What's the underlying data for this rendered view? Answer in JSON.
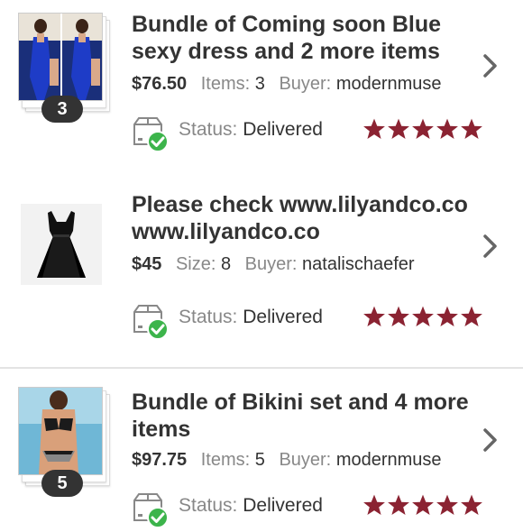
{
  "orders": [
    {
      "title": "Bundle of Coming soon Blue sexy dress and 2 more items",
      "price": "$76.50",
      "detail_label": "Items:",
      "detail_value": "3",
      "buyer_label": "Buyer:",
      "buyer": "modernmuse",
      "count_badge": "3",
      "status_label": "Status:",
      "status": "Delivered",
      "rating": 5
    },
    {
      "title": "Please check www.lilyandco.co www.lilyandco.co",
      "price": "$45",
      "detail_label": "Size:",
      "detail_value": "8",
      "buyer_label": "Buyer:",
      "buyer": "natalischaefer",
      "status_label": "Status:",
      "status": "Delivered",
      "rating": 5
    },
    {
      "title": "Bundle of Bikini set and 4 more items",
      "price": "$97.75",
      "detail_label": "Items:",
      "detail_value": "5",
      "buyer_label": "Buyer:",
      "buyer": "modernmuse",
      "count_badge": "5",
      "status_label": "Status:",
      "status": "Delivered",
      "rating": 5
    }
  ],
  "colors": {
    "star": "#8b2332",
    "check": "#3cb44b",
    "badge": "#333333"
  },
  "icons": {
    "chevron": "chevron-right-icon",
    "status": "delivered-box-icon",
    "rating": "star-icon"
  }
}
